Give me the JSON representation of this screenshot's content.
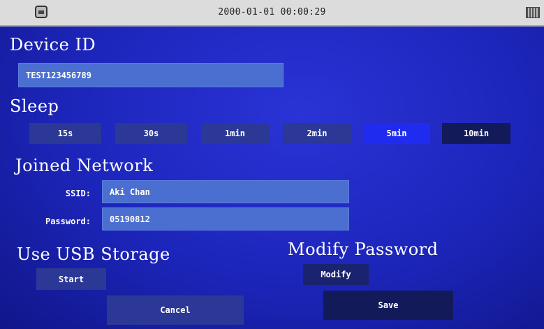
{
  "status_bar": {
    "datetime": "2000-01-01 00:00:29",
    "left_icon": "device-icon",
    "right_icon": "battery-icon"
  },
  "device_id": {
    "title": "Device ID",
    "value": "TEST123456789"
  },
  "sleep": {
    "title": "Sleep",
    "options": [
      "15s",
      "30s",
      "1min",
      "2min",
      "5min",
      "10min"
    ],
    "selected": "5min"
  },
  "network": {
    "title": "Joined Network",
    "ssid_label": "SSID:",
    "ssid_value": "Aki Chan",
    "password_label": "Password:",
    "password_value": "05190812"
  },
  "usb": {
    "title": "Use USB Storage",
    "start_label": "Start"
  },
  "modify_password": {
    "title": "Modify Password",
    "modify_label": "Modify"
  },
  "footer": {
    "cancel_label": "Cancel",
    "save_label": "Save"
  },
  "colors": {
    "background": "#1c25b9",
    "field": "#4a6fd1",
    "button": "#2b3896",
    "selected_button": "#1f2cf0"
  }
}
